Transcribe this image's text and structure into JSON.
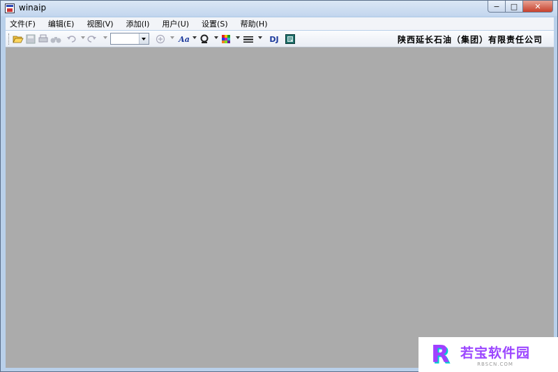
{
  "window": {
    "title": "winaip"
  },
  "controls": {
    "minimize": "−",
    "maximize": "□",
    "close": "✕"
  },
  "menu": {
    "items": [
      {
        "label": "文件(F)"
      },
      {
        "label": "编辑(E)"
      },
      {
        "label": "视图(V)"
      },
      {
        "label": "添加(I)"
      },
      {
        "label": "用户(U)"
      },
      {
        "label": "设置(S)"
      },
      {
        "label": "帮助(H)"
      }
    ]
  },
  "toolbar": {
    "combo_value": "",
    "font_label": "Aa",
    "dj_label": "DJ",
    "company": "陕西延长石油（集团）有限责任公司"
  },
  "icons": {
    "open": "open-folder-icon",
    "save": "save-icon",
    "print": "print-icon",
    "find": "binoculars-icon",
    "undo": "undo-icon",
    "redo": "redo-icon",
    "zoom": "zoom-icon",
    "font": "font-icon",
    "symbol": "symbol-icon",
    "color": "color-grid-icon",
    "line": "line-style-icon",
    "export": "export-icon"
  },
  "watermark": {
    "title": "若宝软件园",
    "subtitle": "RBSCN.COM"
  },
  "colors": {
    "workspace": "#ababab",
    "close_button": "#c7412c",
    "watermark_accent": "#9b45ff"
  }
}
